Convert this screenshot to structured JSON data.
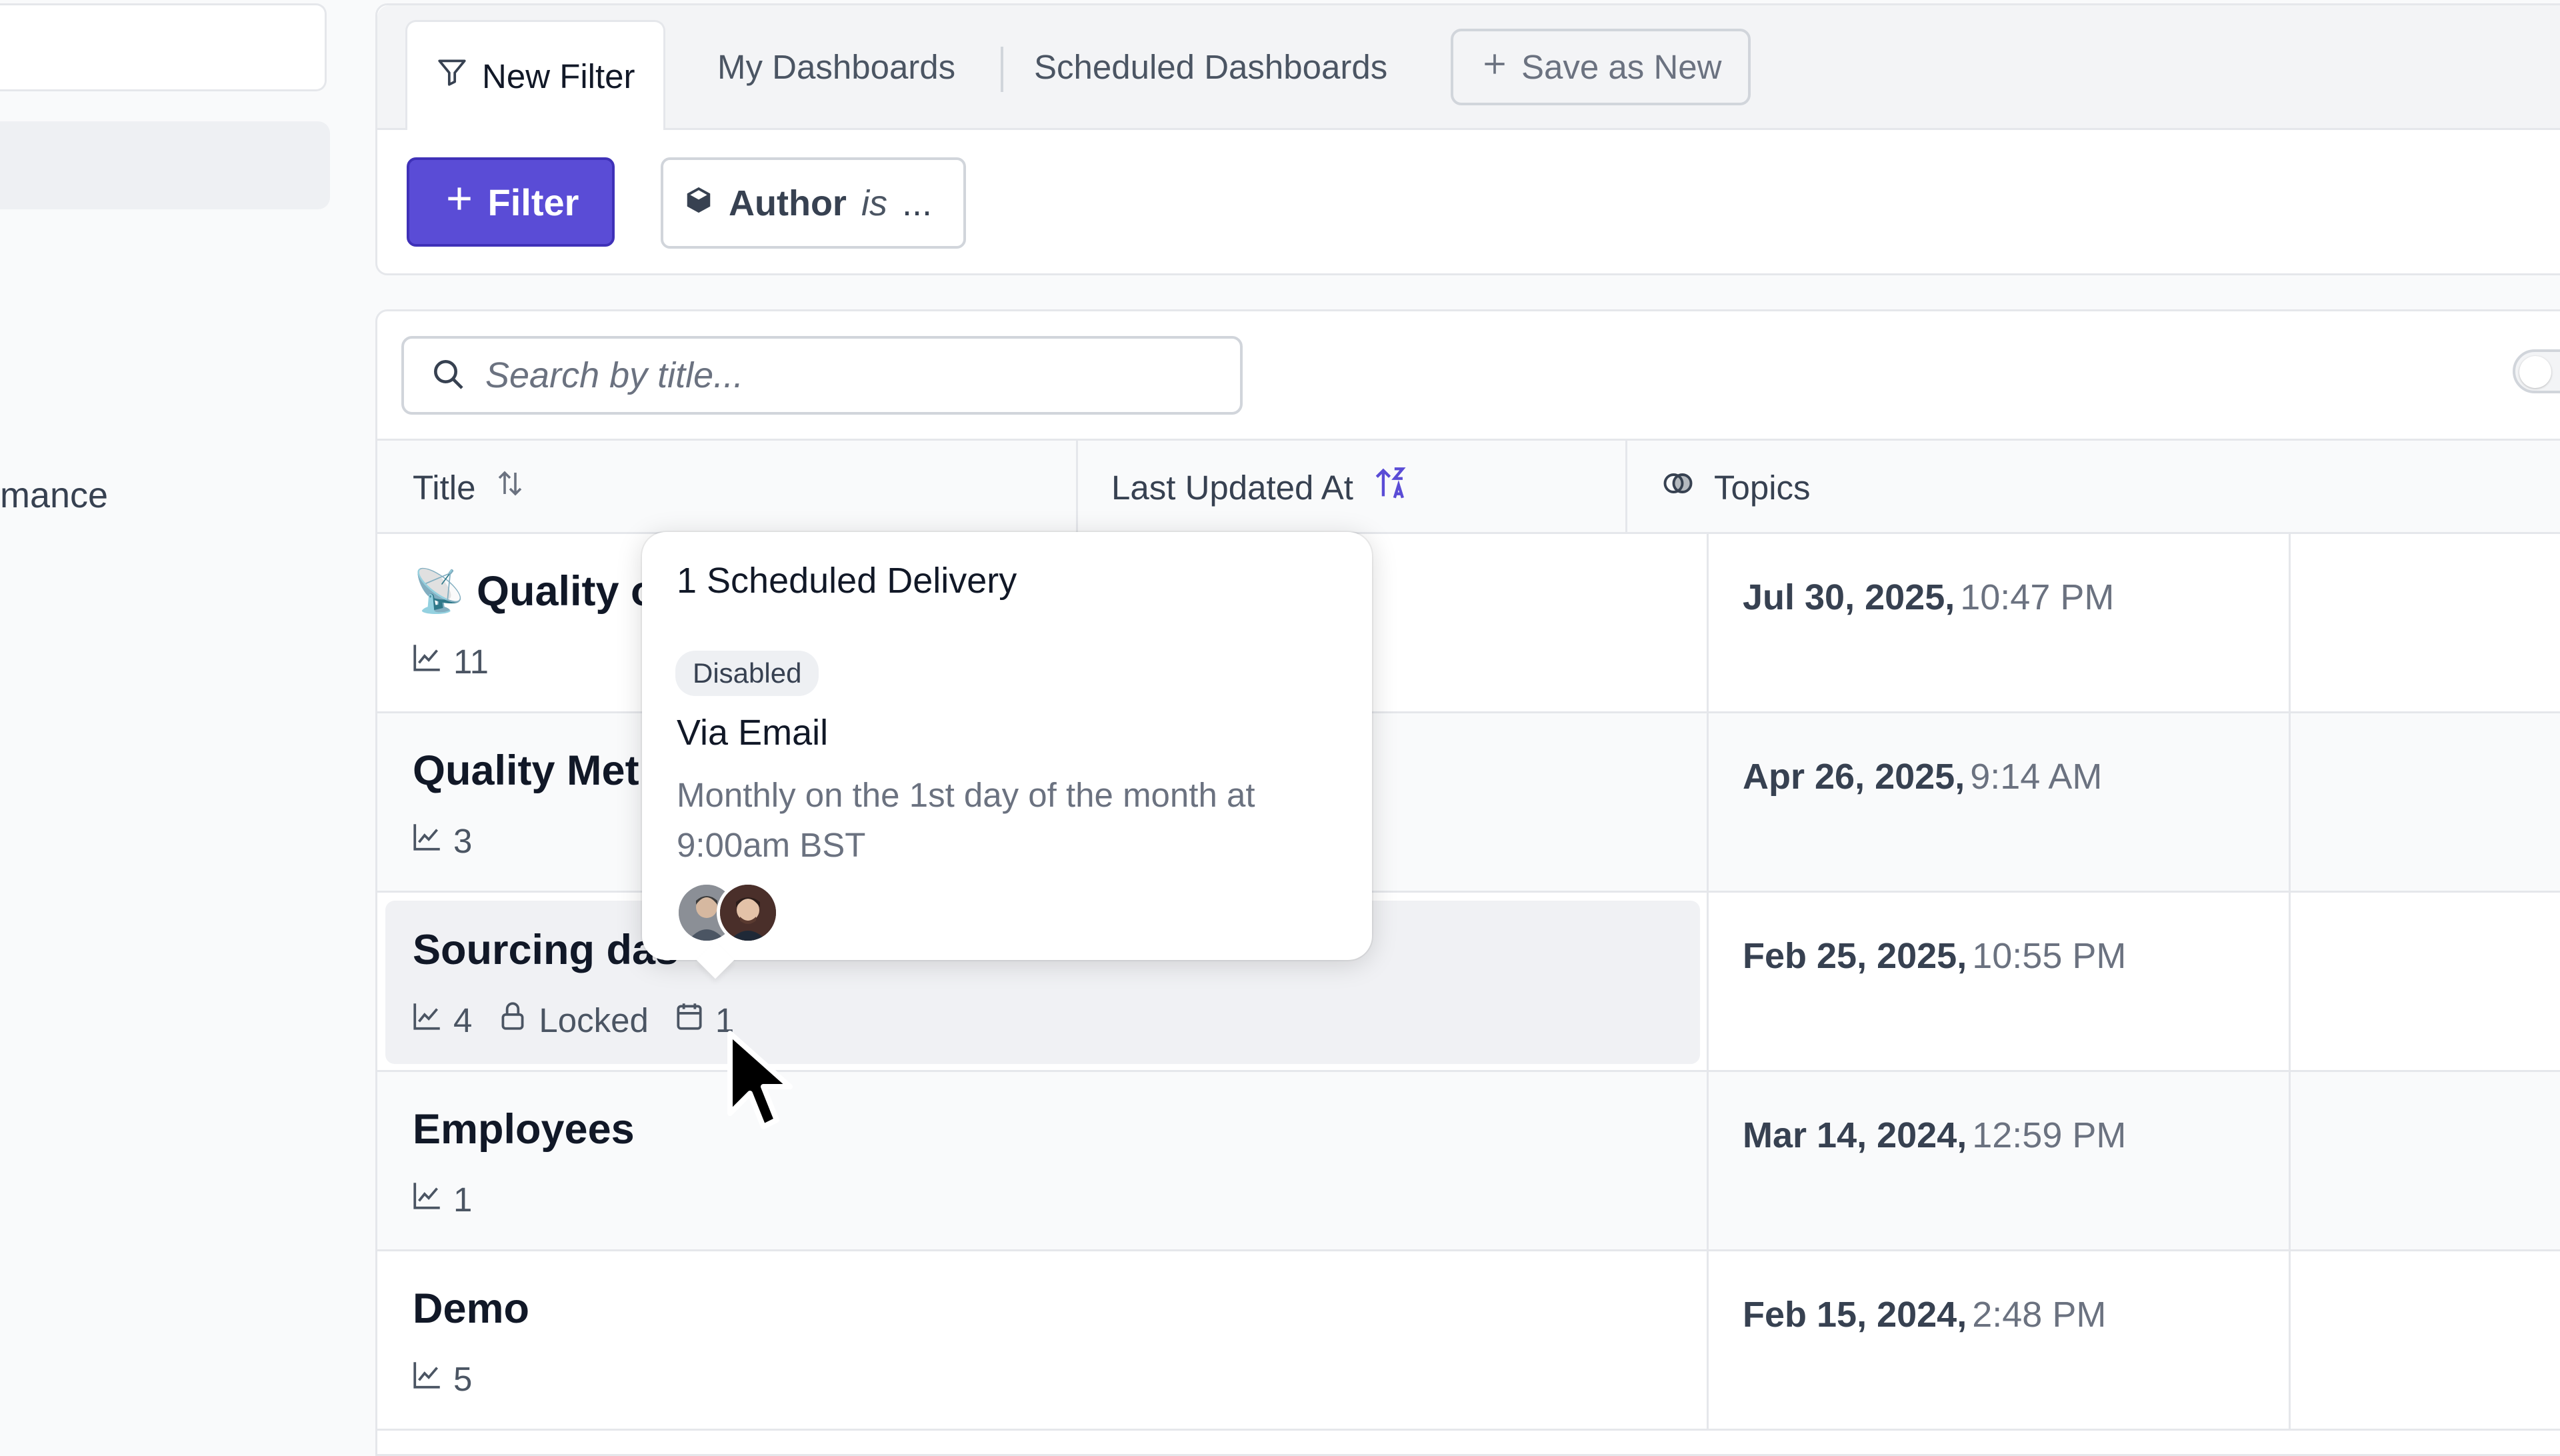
{
  "sidebar": {
    "partial_item_label": "mance"
  },
  "tabs": {
    "new_filter": "New Filter",
    "my_dashboards": "My Dashboards",
    "scheduled_dashboards": "Scheduled Dashboards",
    "save_as_new": "Save as New"
  },
  "filters": {
    "add_filter_label": "Filter",
    "chip": {
      "field": "Author",
      "operator": "is",
      "value": "..."
    }
  },
  "search": {
    "placeholder": "Search by title..."
  },
  "table": {
    "columns": {
      "title": "Title",
      "last_updated": "Last Updated At",
      "topics": "Topics"
    },
    "rows": [
      {
        "title": "Quality o",
        "charts": "11",
        "date": "Jul 30, 2025,",
        "time": "10:47 PM",
        "emoji": "satellite-dish"
      },
      {
        "title": "Quality Met",
        "charts": "3",
        "date": "Apr 26, 2025,",
        "time": "9:14 AM"
      },
      {
        "title": "Sourcing das",
        "charts": "4",
        "locked_label": "Locked",
        "schedules": "1",
        "date": "Feb 25, 2025,",
        "time": "10:55 PM"
      },
      {
        "title": "Employees",
        "charts": "1",
        "date": "Mar 14, 2024,",
        "time": "12:59 PM"
      },
      {
        "title": "Demo",
        "charts": "5",
        "date": "Feb 15, 2024,",
        "time": "2:48 PM"
      }
    ]
  },
  "popover": {
    "title": "1 Scheduled Delivery",
    "status_badge": "Disabled",
    "channel": "Via Email",
    "description": "Monthly on the 1st day of the month at 9:00am BST"
  },
  "colors": {
    "accent": "#5a4cd6",
    "border": "#e5e7eb",
    "muted_text": "#6b7280"
  }
}
